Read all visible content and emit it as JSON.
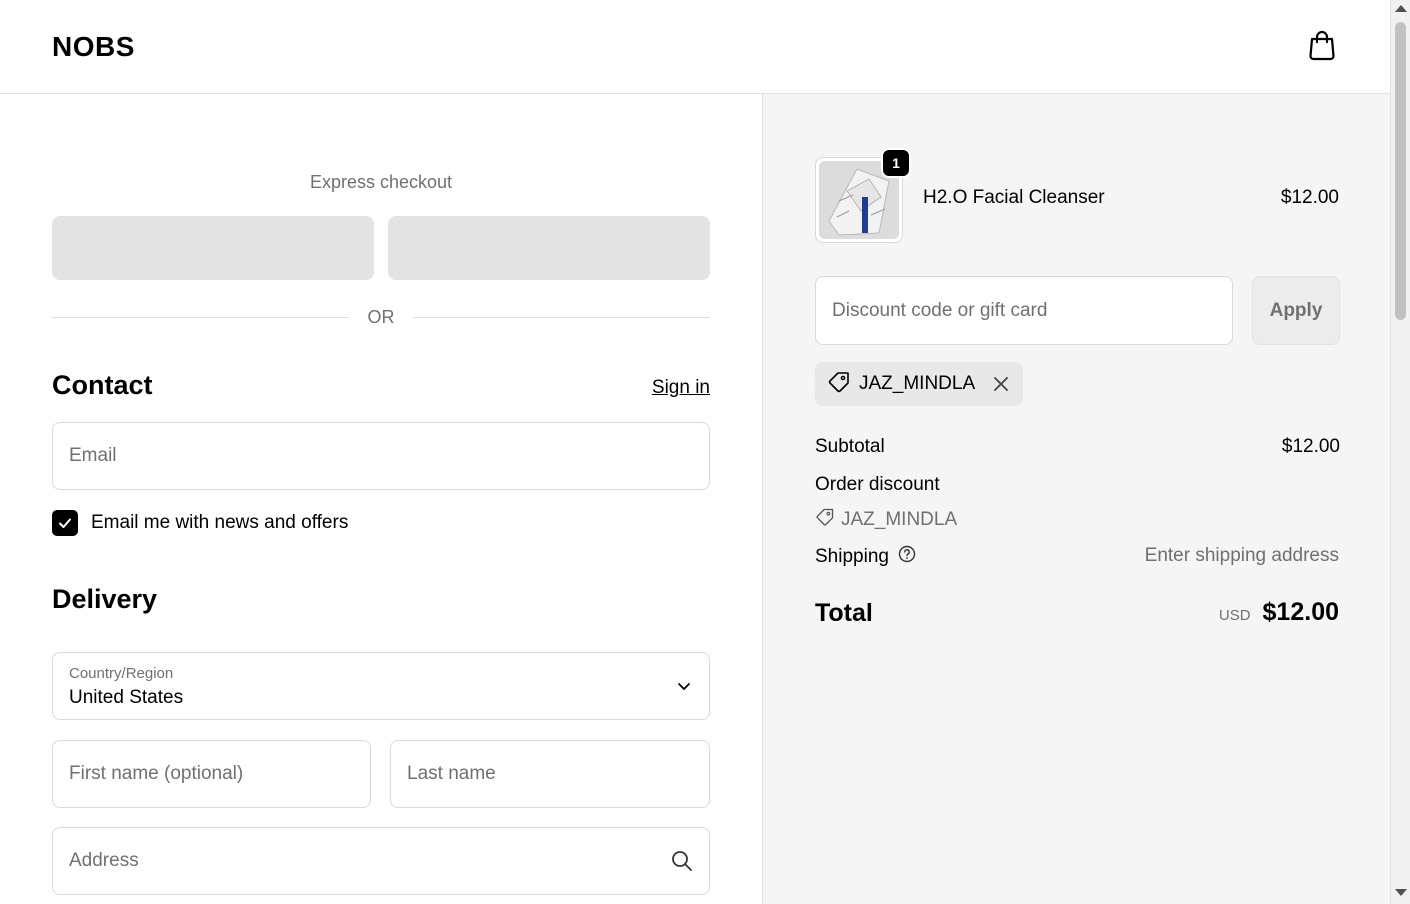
{
  "header": {
    "brand": "NOBS",
    "cart_icon": "shopping-bag-icon"
  },
  "express": {
    "title": "Express checkout",
    "divider": "OR"
  },
  "contact": {
    "title": "Contact",
    "signin": "Sign in",
    "email_placeholder": "Email",
    "newsletter_label": "Email me with news and offers",
    "newsletter_checked": true
  },
  "delivery": {
    "title": "Delivery",
    "country_label": "Country/Region",
    "country_value": "United States",
    "first_name_placeholder": "First name (optional)",
    "last_name_placeholder": "Last name",
    "address_placeholder": "Address"
  },
  "summary": {
    "product": {
      "name": "H2.O Facial Cleanser",
      "price": "$12.00",
      "quantity": "1"
    },
    "discount_placeholder": "Discount code or gift card",
    "apply_label": "Apply",
    "applied_code": "JAZ_MINDLA",
    "subtotal_label": "Subtotal",
    "subtotal_value": "$12.00",
    "order_discount_label": "Order discount",
    "order_discount_code": "JAZ_MINDLA",
    "shipping_label": "Shipping",
    "shipping_value": "Enter shipping address",
    "total_label": "Total",
    "total_currency": "USD",
    "total_value": "$12.00"
  }
}
